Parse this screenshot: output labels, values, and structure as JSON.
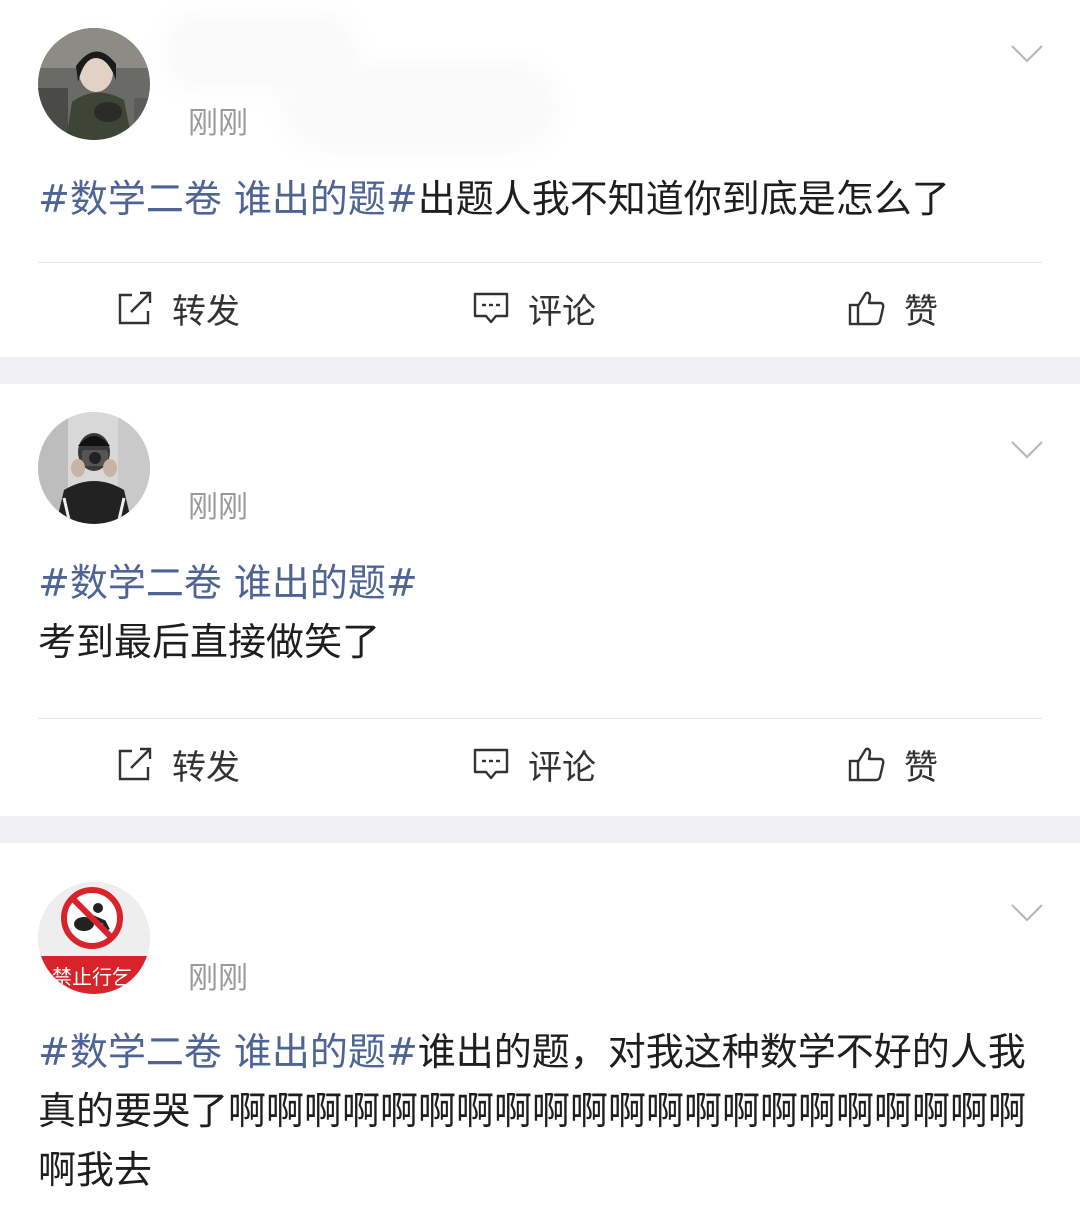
{
  "posts": [
    {
      "time": "刚刚",
      "hashtag": "#数学二卷 谁出的题#",
      "text": "出题人我不知道你到底是怎么了",
      "actions": {
        "repost": "转发",
        "comment": "评论",
        "like": "赞"
      }
    },
    {
      "time": "刚刚",
      "hashtag": "#数学二卷 谁出的题#",
      "text": "考到最后直接做笑了",
      "actions": {
        "repost": "转发",
        "comment": "评论",
        "like": "赞"
      }
    },
    {
      "time": "刚刚",
      "hashtag": "#数学二卷 谁出的题#",
      "text": "谁出的题，对我这种数学不好的人我真的要哭了啊啊啊啊啊啊啊啊啊啊啊啊啊啊啊啊啊啊啊啊啊啊我去",
      "avatar_sign_text": "禁止行乞"
    }
  ],
  "colors": {
    "hashtag": "#4d6494",
    "time": "#9a9a9a",
    "separator": "#f0f0f2"
  },
  "icons": [
    "chevron-down-icon",
    "repost-icon",
    "comment-icon",
    "thumbs-up-icon"
  ]
}
